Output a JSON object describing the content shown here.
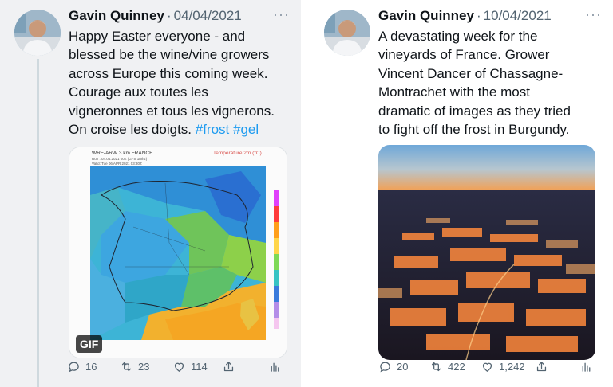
{
  "tweets": [
    {
      "author": "Gavin Quinney",
      "separator": "·",
      "date": "04/04/2021",
      "more": "···",
      "text_lines": [
        "Happy Easter everyone - and",
        "blessed be the wine/vine growers",
        "across Europe this coming week.",
        "Courage aux toutes les",
        "vigneronnes et tous les vignerons.",
        "On croise les doigts. "
      ],
      "hashtags": [
        "#frost",
        "#gel"
      ],
      "media": {
        "type": "gif",
        "badge": "GIF",
        "map_title_line1": "WRF-ARW 3 km FRANCE",
        "map_title_right": "Temperature 2m (°C)",
        "map_run_line": "Run : 04.04.2021 00Z (GFS 1Mhz)",
        "map_valid_line": "Valid: Tue 06 APR 2021 03:30Z"
      },
      "actions": {
        "replies": "16",
        "retweets": "23",
        "likes": "114"
      }
    },
    {
      "author": "Gavin Quinney",
      "separator": "·",
      "date": "10/04/2021",
      "more": "···",
      "text_lines": [
        "A devastating week for the",
        "vineyards of France. Grower",
        "Vincent Dancer of Chassagne-",
        "Montrachet with the most",
        "dramatic of images as they tried",
        "to fight off the frost in Burgundy."
      ],
      "media": {
        "type": "photo"
      },
      "actions": {
        "replies": "20",
        "retweets": "422",
        "likes": "1,242"
      }
    }
  ],
  "icons": {
    "reply": "reply-icon",
    "retweet": "retweet-icon",
    "like": "heart-icon",
    "share": "share-icon",
    "analytics": "analytics-icon"
  },
  "colors": {
    "link": "#1d9bf0",
    "muted": "#536471",
    "left_background": "#f0f1f3"
  }
}
